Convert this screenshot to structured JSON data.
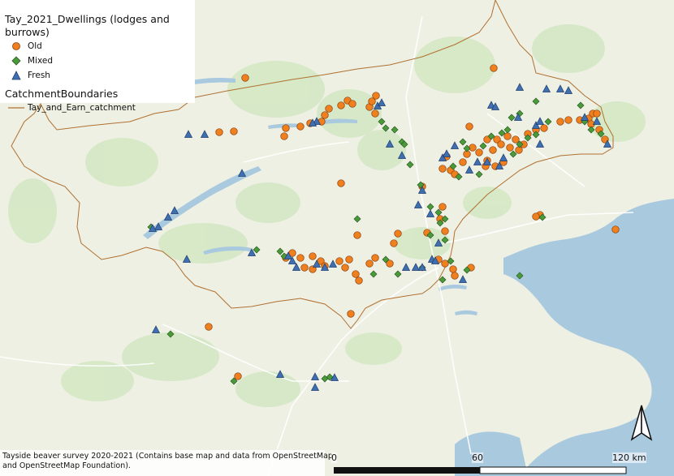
{
  "legend": {
    "layer_title": "Tay_2021_Dwellings (lodges and burrows)",
    "items": [
      {
        "label": "Old",
        "color": "#f0801e",
        "symbol": "circle-icon"
      },
      {
        "label": "Mixed",
        "color": "#4a9a3a",
        "symbol": "diamond-icon"
      },
      {
        "label": "Fresh",
        "color": "#3f6fb0",
        "symbol": "triangle-icon"
      }
    ],
    "boundary_title": "CatchmentBoundaries",
    "boundary_label": "Tay_and_Earn_catchment",
    "boundary_color": "#b07030"
  },
  "credit": {
    "line1": "Tayside beaver survey 2020-2021 (Contains base map and data from OpenStreetMap",
    "line2": "and OpenStreetMap Foundation)."
  },
  "scale": {
    "label_0": "0",
    "label_60": "60",
    "label_120": "120 km"
  },
  "north_arrow": "north-arrow-icon",
  "colors": {
    "land": "#eef0e4",
    "water": "#a9c9de",
    "green": "#d0e6c0",
    "old": "#f0801e",
    "mixed": "#4a9a3a",
    "fresh": "#3f6fb0",
    "boundary": "#b07030"
  }
}
